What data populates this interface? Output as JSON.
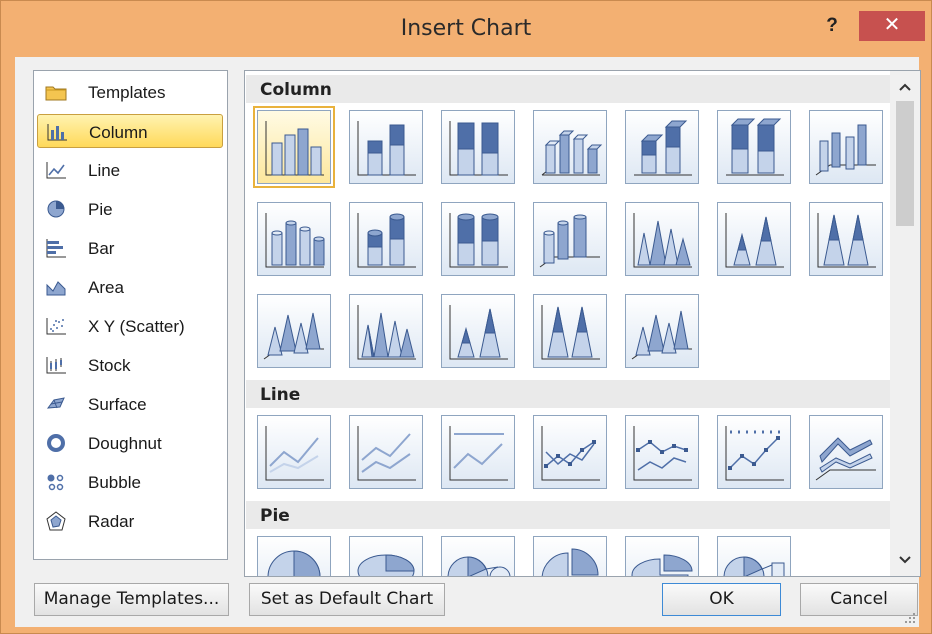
{
  "window": {
    "title": "Insert Chart",
    "help": "?",
    "close": "✕"
  },
  "sidebar": {
    "items": [
      {
        "label": "Templates",
        "icon": "folder-icon"
      },
      {
        "label": "Column",
        "icon": "column-chart-icon",
        "selected": true
      },
      {
        "label": "Line",
        "icon": "line-chart-icon"
      },
      {
        "label": "Pie",
        "icon": "pie-chart-icon"
      },
      {
        "label": "Bar",
        "icon": "bar-chart-icon"
      },
      {
        "label": "Area",
        "icon": "area-chart-icon"
      },
      {
        "label": "X Y (Scatter)",
        "icon": "scatter-chart-icon"
      },
      {
        "label": "Stock",
        "icon": "stock-chart-icon"
      },
      {
        "label": "Surface",
        "icon": "surface-chart-icon"
      },
      {
        "label": "Doughnut",
        "icon": "doughnut-chart-icon"
      },
      {
        "label": "Bubble",
        "icon": "bubble-chart-icon"
      },
      {
        "label": "Radar",
        "icon": "radar-chart-icon"
      }
    ]
  },
  "gallery": {
    "sections": [
      {
        "heading": "Column"
      },
      {
        "heading": "Line"
      },
      {
        "heading": "Pie"
      }
    ]
  },
  "scrollbar": {
    "up": "^",
    "down": "v"
  },
  "buttons": {
    "manage_templates": "Manage Templates...",
    "set_default": "Set as Default Chart",
    "ok": "OK",
    "cancel": "Cancel"
  },
  "colors": {
    "title_bar": "#f3b072",
    "close_button": "#c7514f",
    "selection": "#ffd95a",
    "chart_blue": "#4f6fa8"
  }
}
